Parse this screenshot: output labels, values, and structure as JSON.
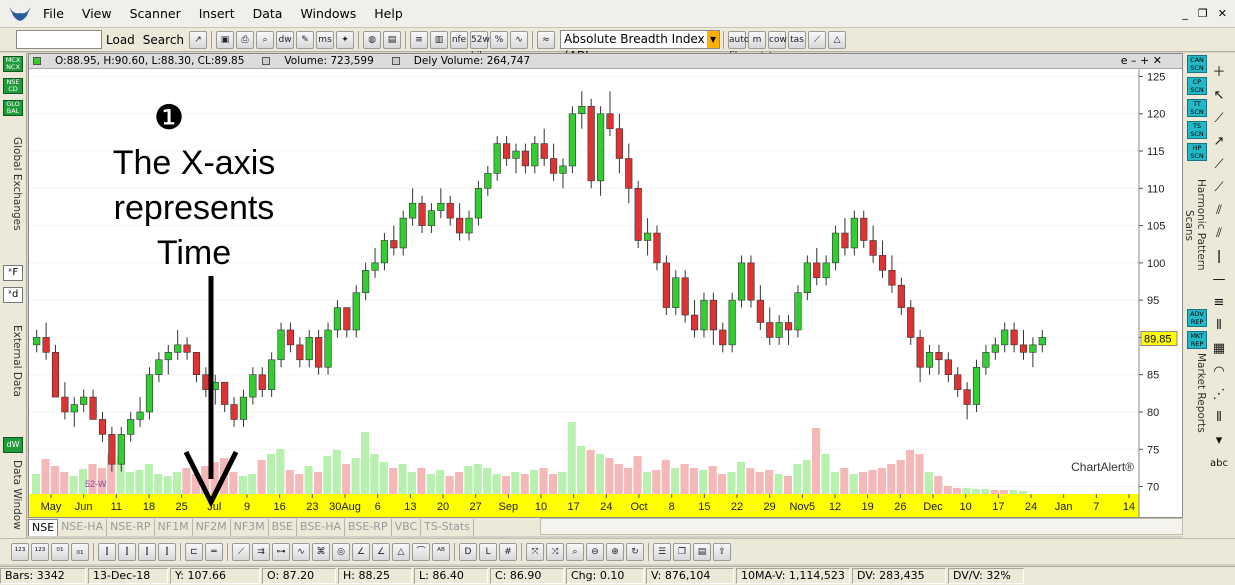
{
  "menu": {
    "items": [
      "File",
      "View",
      "Scanner",
      "Insert",
      "Data",
      "Windows",
      "Help"
    ]
  },
  "toolbar": {
    "load_label": "Load",
    "search_label": "Search",
    "indicator_value": "Absolute Breadth Index (ABI",
    "icons": [
      "dw",
      "ms",
      "nfe",
      "52w hilo",
      "auto fibo",
      "m pvt",
      "cow tam",
      "tas"
    ]
  },
  "left_panel": {
    "buttons": [
      "MCX NCX",
      "NSE CD",
      "GLO BAL"
    ],
    "global_label": "Global Exchanges",
    "external_label": "External Data",
    "data_window_label": "Data Window",
    "dw_icon": "dW"
  },
  "right_panel": {
    "scan_buttons": [
      "CAN SCN",
      "CP SCN",
      "TT SCN",
      "TS SCN",
      "HP SCN"
    ],
    "harmonic_label": "Harmonic Pattern Scans",
    "report_buttons": [
      "ADV REP",
      "MKT REP"
    ],
    "market_label": "Market Reports",
    "abc_label": "abc"
  },
  "chart_header": {
    "ohlc": "O:88.95, H:90.60, L:88.30, CL:89.85",
    "volume": "Volume: 723,599",
    "dely_volume": "Dely Volume: 264,747",
    "controls": "e – + ✕",
    "color_green": "#22aa22",
    "color_red": "#cc2222",
    "ohlc_swatch": "#33cc33",
    "vol_swatch": "#cccccc"
  },
  "annotation": {
    "number": "❶",
    "line1": "The X-axis",
    "line2": "represents",
    "line3": "Time"
  },
  "chart_data": {
    "type": "candlestick",
    "ylim": [
      69,
      126
    ],
    "y_ticks": [
      70,
      75,
      80,
      85,
      90,
      95,
      100,
      105,
      110,
      115,
      120,
      125
    ],
    "x_ticks": [
      "May",
      "Jun",
      "11",
      "18",
      "25",
      "Jul",
      "9",
      "16",
      "23",
      "30Aug",
      "6",
      "13",
      "20",
      "27",
      "Sep",
      "10",
      "17",
      "24",
      "Oct",
      "8",
      "15",
      "22",
      "29",
      "Nov5",
      "12",
      "19",
      "26",
      "Dec",
      "10",
      "17",
      "24",
      "Jan",
      "7",
      "14"
    ],
    "last_price": "89.85",
    "watermark": "ChartAlert®",
    "low_label": "52-W",
    "up_color": "#33cc33",
    "down_color": "#dd3333",
    "vol_up_color": "#b8f0b0",
    "vol_down_color": "#f5b8b8",
    "axis_band_color": "#ffff00",
    "candles": [
      [
        89,
        91,
        88,
        90
      ],
      [
        90,
        92,
        87,
        88
      ],
      [
        88,
        89,
        82,
        82
      ],
      [
        82,
        84,
        79,
        80
      ],
      [
        80,
        82,
        78,
        81
      ],
      [
        81,
        83,
        80,
        82
      ],
      [
        82,
        83,
        79,
        79
      ],
      [
        79,
        80,
        76,
        77
      ],
      [
        77,
        78,
        72,
        73
      ],
      [
        73,
        78,
        72,
        77
      ],
      [
        77,
        80,
        76,
        79
      ],
      [
        79,
        82,
        78,
        80
      ],
      [
        80,
        86,
        79,
        85
      ],
      [
        85,
        88,
        84,
        87
      ],
      [
        87,
        89,
        85,
        88
      ],
      [
        88,
        91,
        87,
        89
      ],
      [
        89,
        90,
        87,
        88
      ],
      [
        88,
        88,
        84,
        85
      ],
      [
        85,
        86,
        82,
        83
      ],
      [
        83,
        85,
        81,
        84
      ],
      [
        84,
        84,
        80,
        81
      ],
      [
        81,
        82,
        78,
        79
      ],
      [
        79,
        83,
        78,
        82
      ],
      [
        82,
        86,
        81,
        85
      ],
      [
        85,
        86,
        82,
        83
      ],
      [
        83,
        88,
        82,
        87
      ],
      [
        87,
        92,
        86,
        91
      ],
      [
        91,
        92,
        88,
        89
      ],
      [
        89,
        90,
        86,
        87
      ],
      [
        87,
        91,
        86,
        90
      ],
      [
        90,
        91,
        85,
        86
      ],
      [
        86,
        92,
        85,
        91
      ],
      [
        91,
        95,
        90,
        94
      ],
      [
        94,
        94,
        90,
        91
      ],
      [
        91,
        97,
        90,
        96
      ],
      [
        96,
        100,
        95,
        99
      ],
      [
        99,
        102,
        98,
        100
      ],
      [
        100,
        104,
        99,
        103
      ],
      [
        103,
        105,
        101,
        102
      ],
      [
        102,
        107,
        101,
        106
      ],
      [
        106,
        110,
        105,
        108
      ],
      [
        108,
        109,
        104,
        105
      ],
      [
        105,
        108,
        104,
        107
      ],
      [
        107,
        110,
        106,
        108
      ],
      [
        108,
        109,
        105,
        106
      ],
      [
        106,
        108,
        103,
        104
      ],
      [
        104,
        107,
        103,
        106
      ],
      [
        106,
        111,
        105,
        110
      ],
      [
        110,
        113,
        109,
        112
      ],
      [
        112,
        117,
        111,
        116
      ],
      [
        116,
        117,
        113,
        114
      ],
      [
        114,
        116,
        112,
        115
      ],
      [
        115,
        116,
        112,
        113
      ],
      [
        113,
        117,
        112,
        116
      ],
      [
        116,
        118,
        113,
        114
      ],
      [
        114,
        116,
        111,
        112
      ],
      [
        112,
        114,
        110,
        113
      ],
      [
        113,
        121,
        112,
        120
      ],
      [
        120,
        123,
        118,
        121
      ],
      [
        121,
        122,
        110,
        111
      ],
      [
        111,
        121,
        109,
        120
      ],
      [
        120,
        123,
        117,
        118
      ],
      [
        118,
        120,
        112,
        114
      ],
      [
        114,
        116,
        108,
        110
      ],
      [
        110,
        111,
        102,
        103
      ],
      [
        103,
        106,
        101,
        104
      ],
      [
        104,
        105,
        99,
        100
      ],
      [
        100,
        101,
        93,
        94
      ],
      [
        94,
        99,
        93,
        98
      ],
      [
        98,
        99,
        92,
        93
      ],
      [
        93,
        95,
        90,
        91
      ],
      [
        91,
        96,
        90,
        95
      ],
      [
        95,
        96,
        89,
        91
      ],
      [
        91,
        92,
        88,
        89
      ],
      [
        89,
        96,
        88,
        95
      ],
      [
        95,
        101,
        94,
        100
      ],
      [
        100,
        101,
        94,
        95
      ],
      [
        95,
        97,
        91,
        92
      ],
      [
        92,
        94,
        89,
        90
      ],
      [
        90,
        93,
        89,
        92
      ],
      [
        92,
        93,
        89,
        91
      ],
      [
        91,
        97,
        90,
        96
      ],
      [
        96,
        101,
        95,
        100
      ],
      [
        100,
        102,
        97,
        98
      ],
      [
        98,
        101,
        97,
        100
      ],
      [
        100,
        105,
        99,
        104
      ],
      [
        104,
        106,
        101,
        102
      ],
      [
        102,
        107,
        101,
        106
      ],
      [
        106,
        107,
        102,
        103
      ],
      [
        103,
        105,
        100,
        101
      ],
      [
        101,
        103,
        98,
        99
      ],
      [
        99,
        101,
        96,
        97
      ],
      [
        97,
        98,
        93,
        94
      ],
      [
        94,
        95,
        89,
        90
      ],
      [
        90,
        91,
        84,
        86
      ],
      [
        86,
        89,
        85,
        88
      ],
      [
        88,
        89,
        85,
        87
      ],
      [
        87,
        88,
        84,
        85
      ],
      [
        85,
        86,
        82,
        83
      ],
      [
        83,
        84,
        79,
        81
      ],
      [
        81,
        87,
        80,
        86
      ],
      [
        86,
        89,
        85,
        88
      ],
      [
        88,
        90,
        87,
        89
      ],
      [
        89,
        92,
        88,
        91
      ],
      [
        91,
        92,
        88,
        89
      ],
      [
        89,
        91,
        87,
        88
      ],
      [
        88,
        90,
        86,
        89
      ],
      [
        89,
        91,
        88,
        90
      ]
    ],
    "volumes": [
      [
        20,
        0
      ],
      [
        35,
        1
      ],
      [
        28,
        1
      ],
      [
        22,
        1
      ],
      [
        18,
        0
      ],
      [
        25,
        0
      ],
      [
        30,
        1
      ],
      [
        26,
        1
      ],
      [
        40,
        1
      ],
      [
        38,
        0
      ],
      [
        22,
        0
      ],
      [
        24,
        0
      ],
      [
        30,
        0
      ],
      [
        20,
        0
      ],
      [
        18,
        0
      ],
      [
        22,
        0
      ],
      [
        26,
        1
      ],
      [
        20,
        1
      ],
      [
        28,
        1
      ],
      [
        32,
        1
      ],
      [
        36,
        1
      ],
      [
        22,
        1
      ],
      [
        18,
        0
      ],
      [
        20,
        0
      ],
      [
        34,
        1
      ],
      [
        40,
        0
      ],
      [
        45,
        0
      ],
      [
        24,
        1
      ],
      [
        20,
        1
      ],
      [
        28,
        0
      ],
      [
        22,
        1
      ],
      [
        38,
        0
      ],
      [
        44,
        0
      ],
      [
        30,
        1
      ],
      [
        36,
        0
      ],
      [
        62,
        0
      ],
      [
        40,
        0
      ],
      [
        32,
        0
      ],
      [
        26,
        1
      ],
      [
        30,
        0
      ],
      [
        22,
        0
      ],
      [
        26,
        1
      ],
      [
        20,
        0
      ],
      [
        24,
        0
      ],
      [
        18,
        1
      ],
      [
        22,
        1
      ],
      [
        28,
        0
      ],
      [
        30,
        0
      ],
      [
        26,
        0
      ],
      [
        20,
        0
      ],
      [
        18,
        1
      ],
      [
        22,
        0
      ],
      [
        20,
        1
      ],
      [
        24,
        0
      ],
      [
        26,
        1
      ],
      [
        20,
        1
      ],
      [
        22,
        0
      ],
      [
        72,
        0
      ],
      [
        48,
        0
      ],
      [
        44,
        1
      ],
      [
        40,
        0
      ],
      [
        36,
        1
      ],
      [
        30,
        1
      ],
      [
        26,
        1
      ],
      [
        38,
        1
      ],
      [
        22,
        0
      ],
      [
        24,
        1
      ],
      [
        34,
        1
      ],
      [
        26,
        0
      ],
      [
        30,
        1
      ],
      [
        26,
        1
      ],
      [
        24,
        0
      ],
      [
        28,
        1
      ],
      [
        20,
        1
      ],
      [
        22,
        0
      ],
      [
        32,
        0
      ],
      [
        26,
        1
      ],
      [
        22,
        1
      ],
      [
        24,
        1
      ],
      [
        20,
        0
      ],
      [
        18,
        1
      ],
      [
        30,
        0
      ],
      [
        34,
        0
      ],
      [
        66,
        1
      ],
      [
        40,
        0
      ],
      [
        22,
        0
      ],
      [
        26,
        1
      ],
      [
        20,
        0
      ],
      [
        22,
        1
      ],
      [
        24,
        1
      ],
      [
        26,
        1
      ],
      [
        30,
        1
      ],
      [
        34,
        1
      ],
      [
        44,
        1
      ],
      [
        40,
        1
      ],
      [
        22,
        0
      ],
      [
        18,
        1
      ],
      [
        8,
        1
      ],
      [
        6,
        1
      ],
      [
        6,
        0
      ],
      [
        5,
        0
      ],
      [
        5,
        0
      ],
      [
        4,
        1
      ],
      [
        4,
        1
      ],
      [
        4,
        0
      ],
      [
        3,
        0
      ]
    ]
  }
}
